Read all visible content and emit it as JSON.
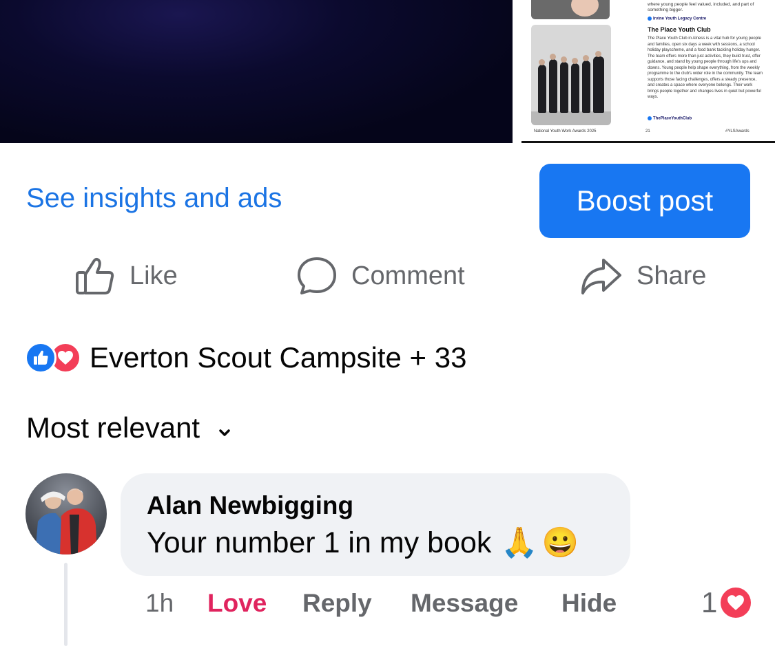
{
  "media": {
    "page_photo": {
      "intro_text": "where young people feel valued, included, and part of something bigger.",
      "link_1": "Irvine Youth Legacy Centre",
      "club_title": "The Place Youth Club",
      "club_body": "The Place Youth Club in Alness is a vital hub for young people and families, open six days a week with sessions, a school holiday playscheme, and a food bank tackling holiday hunger. The team offers more than just activities, they build trust, offer guidance, and stand by young people through life's ups and downs. Young people help shape everything, from the weekly programme to the club's wider role in the community. The team supports those facing challenges, offers a steady presence, and creates a space where everyone belongs. Their work brings people together and changes lives in quiet but powerful ways.",
      "link_2": "ThePlaceYouthClub",
      "footer_left": "National Youth Work Awards 2025",
      "page_number": "21",
      "footer_right": "#YLSAwards"
    }
  },
  "actions": {
    "insights_label": "See insights and ads",
    "boost_label": "Boost post",
    "like_label": "Like",
    "comment_label": "Comment",
    "share_label": "Share"
  },
  "reactions": {
    "summary_text": "Everton Scout Campsite + 33",
    "icons": [
      "like-reaction-icon",
      "love-reaction-icon"
    ]
  },
  "sort": {
    "label": "Most relevant"
  },
  "comment": {
    "author": "Alan Newbigging",
    "text": "Your number 1 in my book",
    "emojis": [
      "🙏",
      "😀"
    ],
    "time": "1h",
    "love_label": "Love",
    "reply_label": "Reply",
    "message_label": "Message",
    "hide_label": "Hide",
    "reaction_count": "1"
  },
  "colors": {
    "accent": "#1877f2",
    "link": "#1b74e4",
    "love": "#e0245e",
    "secondary_text": "#65676b",
    "bubble": "#f0f2f5"
  }
}
